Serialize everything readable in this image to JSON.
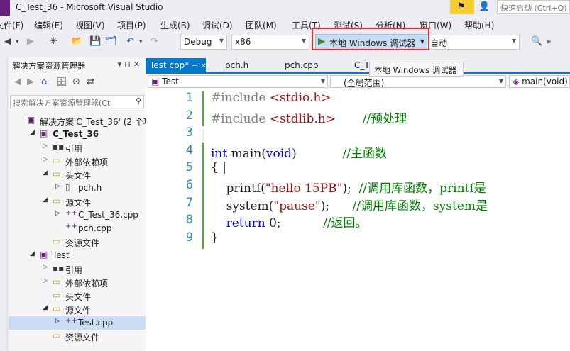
{
  "window": {
    "title": "C_Test_36 - Microsoft Visual Studio",
    "quick_launch_placeholder": "快速启动 (Ctrl+Q)"
  },
  "menu": [
    "文件(F)",
    "编辑(E)",
    "视图(V)",
    "项目(P)",
    "生成(B)",
    "调试(D)",
    "团队(M)",
    "工具(T)",
    "测试(S)",
    "分析(N)",
    "窗口(W)",
    "帮助(H)"
  ],
  "toolbar": {
    "config": "Debug",
    "platform": "x86",
    "run_label": "本地 Windows 调试器",
    "run_mode": "自动",
    "tooltip": "本地 Windows 调试器"
  },
  "solution_explorer": {
    "title": "解决方案资源管理器",
    "search_placeholder": "搜索解决方案资源管理器(Ct",
    "tree": [
      {
        "label": "解决方案'C_Test_36' (2 个项",
        "level": 0,
        "icon": "solution-icon",
        "expand": ""
      },
      {
        "label": "C_Test_36",
        "level": 1,
        "icon": "project-icon",
        "expand": "◢",
        "bold": true
      },
      {
        "label": "引用",
        "level": 2,
        "icon": "references-icon",
        "expand": "▷"
      },
      {
        "label": "外部依赖项",
        "level": 2,
        "icon": "folder-icon",
        "expand": "▷"
      },
      {
        "label": "头文件",
        "level": 2,
        "icon": "folder-icon",
        "expand": "◢"
      },
      {
        "label": "pch.h",
        "level": 3,
        "icon": "header-file-icon",
        "expand": "▷"
      },
      {
        "label": "源文件",
        "level": 2,
        "icon": "folder-icon",
        "expand": "◢"
      },
      {
        "label": "C_Test_36.cpp",
        "level": 3,
        "icon": "cpp-file-icon",
        "expand": "▷"
      },
      {
        "label": "pch.cpp",
        "level": 3,
        "icon": "cpp-file-icon",
        "expand": ""
      },
      {
        "label": "资源文件",
        "level": 2,
        "icon": "folder-icon",
        "expand": ""
      },
      {
        "label": "Test",
        "level": 1,
        "icon": "project-icon",
        "expand": "◢"
      },
      {
        "label": "引用",
        "level": 2,
        "icon": "references-icon",
        "expand": "▷"
      },
      {
        "label": "外部依赖项",
        "level": 2,
        "icon": "folder-icon",
        "expand": "▷"
      },
      {
        "label": "头文件",
        "level": 2,
        "icon": "folder-icon",
        "expand": ""
      },
      {
        "label": "源文件",
        "level": 2,
        "icon": "folder-icon",
        "expand": "◢"
      },
      {
        "label": "Test.cpp",
        "level": 3,
        "icon": "cpp-file-icon",
        "expand": "▷",
        "selected": true
      },
      {
        "label": "资源文件",
        "level": 2,
        "icon": "folder-icon",
        "expand": ""
      }
    ]
  },
  "editor": {
    "tabs": [
      "Test.cpp*",
      "pch.h",
      "pch.cpp",
      "C_T"
    ],
    "nav_project": "Test",
    "nav_scope": "(全局范围)",
    "nav_member": "main(void)",
    "lines": [
      {
        "n": "1",
        "parts": [
          {
            "c": "pp",
            "t": "#include "
          },
          {
            "c": "str",
            "t": "<stdio.h>"
          }
        ]
      },
      {
        "n": "2",
        "parts": [
          {
            "c": "pp",
            "t": "#include "
          },
          {
            "c": "str",
            "t": "<stdlib.h>"
          },
          {
            "c": "",
            "t": "       "
          },
          {
            "c": "cm",
            "t": "//预处理"
          }
        ]
      },
      {
        "n": "3",
        "parts": []
      },
      {
        "n": "4",
        "parts": [
          {
            "c": "kw",
            "t": "int"
          },
          {
            "c": "",
            "t": " main("
          },
          {
            "c": "kw",
            "t": "void"
          },
          {
            "c": "",
            "t": ")"
          },
          {
            "c": "",
            "t": "            "
          },
          {
            "c": "cm",
            "t": "//主函数"
          }
        ]
      },
      {
        "n": "5",
        "parts": [
          {
            "c": "",
            "t": "{ |"
          }
        ]
      },
      {
        "n": "6",
        "parts": [
          {
            "c": "",
            "t": "    printf("
          },
          {
            "c": "str",
            "t": "\"hello 15PB\""
          },
          {
            "c": "",
            "t": ");  "
          },
          {
            "c": "cm",
            "t": "//调用库函数，printf是"
          }
        ]
      },
      {
        "n": "7",
        "parts": [
          {
            "c": "",
            "t": "    system("
          },
          {
            "c": "str",
            "t": "\"pause\""
          },
          {
            "c": "",
            "t": ");      "
          },
          {
            "c": "cm",
            "t": "//调用库函数，system是"
          }
        ]
      },
      {
        "n": "8",
        "parts": [
          {
            "c": "",
            "t": "    "
          },
          {
            "c": "kw",
            "t": "return"
          },
          {
            "c": "",
            "t": " 0;           "
          },
          {
            "c": "cm",
            "t": "//返回。"
          }
        ]
      },
      {
        "n": "9",
        "parts": [
          {
            "c": "",
            "t": "}"
          }
        ]
      }
    ]
  },
  "colors": {
    "accent": "#007acc",
    "highlight_border": "#e8282b",
    "keyword": "#0000ff",
    "comment": "#008000",
    "string": "#a31515"
  }
}
